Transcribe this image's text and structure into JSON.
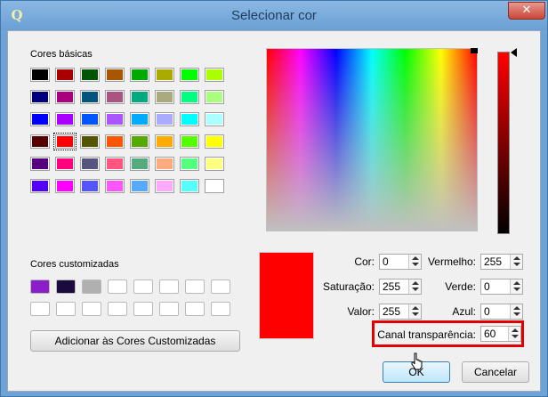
{
  "window": {
    "title": "Selecionar cor",
    "app_icon": "qgis-icon",
    "close_icon": "close-icon",
    "close_glyph": "✕"
  },
  "basic_colors": {
    "label": "Cores básicas",
    "rows": [
      [
        "#000000",
        "#aa0000",
        "#005500",
        "#aa5500",
        "#00aa00",
        "#aaaa00",
        "#00ff00",
        "#aaff00"
      ],
      [
        "#00007f",
        "#aa007f",
        "#00557f",
        "#aa557f",
        "#00aa7f",
        "#aaaa7f",
        "#00ff7f",
        "#aaff7f"
      ],
      [
        "#0000ff",
        "#aa00ff",
        "#0055ff",
        "#aa55ff",
        "#00aaff",
        "#aaaaff",
        "#00ffff",
        "#aaffff"
      ],
      [
        "#550000",
        "#ff0000",
        "#555500",
        "#ff5500",
        "#55aa00",
        "#ffaa00",
        "#55ff00",
        "#ffff00"
      ],
      [
        "#55007f",
        "#ff007f",
        "#55557f",
        "#ff557f",
        "#55aa7f",
        "#ffaa7f",
        "#55ff7f",
        "#ffff7f"
      ],
      [
        "#5500ff",
        "#ff00ff",
        "#5555ff",
        "#ff55ff",
        "#55aaff",
        "#ffaaff",
        "#55ffff",
        "#ffffff"
      ]
    ],
    "selected": "#ff0000"
  },
  "custom_colors": {
    "label": "Cores customizadas",
    "rows": [
      [
        "#8a1fc9",
        "#1a0a3d",
        "#b0b0b0",
        "#ffffff",
        "#ffffff",
        "#ffffff",
        "#ffffff",
        "#ffffff"
      ],
      [
        "#ffffff",
        "#ffffff",
        "#ffffff",
        "#ffffff",
        "#ffffff",
        "#ffffff",
        "#ffffff",
        "#ffffff"
      ]
    ],
    "add_button": "Adicionar às Cores Customizadas"
  },
  "current_color": "#ff0000",
  "fields": {
    "hue": {
      "label": "Cor:",
      "value": "0"
    },
    "saturation": {
      "label": "Saturação:",
      "value": "255"
    },
    "value": {
      "label": "Valor:",
      "value": "255"
    },
    "red": {
      "label": "Vermelho:",
      "value": "255"
    },
    "green": {
      "label": "Verde:",
      "value": "0"
    },
    "blue": {
      "label": "Azul:",
      "value": "0"
    },
    "alpha": {
      "label": "Canal transparência:",
      "value": "60"
    }
  },
  "buttons": {
    "ok": "OK",
    "cancel": "Cancelar"
  },
  "annotation_color": "#e00000"
}
